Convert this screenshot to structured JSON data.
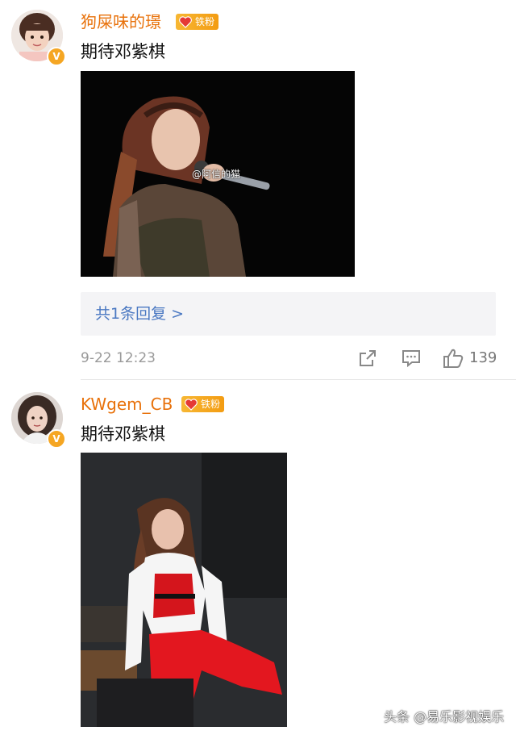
{
  "comments": [
    {
      "username": "狗屎味的璟",
      "fan_badge": "铁粉",
      "verified_mark": "V",
      "text": "期待邓紫棋",
      "image_watermark": "@阿信的猫",
      "reply_link": "共1条回复 >",
      "timestamp": "9-22 12:23",
      "like_count": "139"
    },
    {
      "username": "KWgem_CB",
      "fan_badge": "铁粉",
      "verified_mark": "V",
      "text": "期待邓紫棋"
    }
  ],
  "footer": {
    "watermark": "头条 @易乐影视娱乐"
  },
  "icons": {
    "share": "share-icon",
    "comment": "comment-icon",
    "like": "thumbs-up-icon",
    "fan_badge": "heart-icon"
  },
  "colors": {
    "username": "#e8710a",
    "link": "#4a78c2",
    "badge": "#f5a623",
    "meta": "#999999"
  }
}
